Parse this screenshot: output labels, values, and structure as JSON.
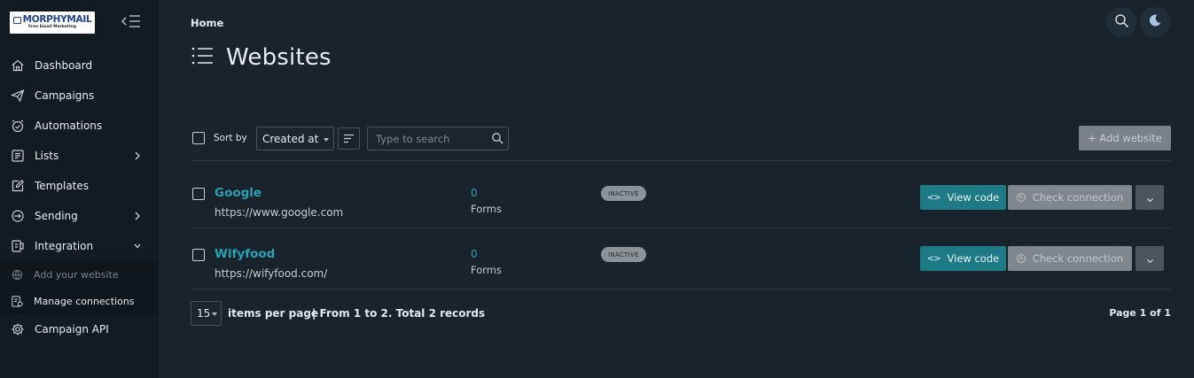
{
  "brand": {
    "name": "MORPHYMAIL",
    "tagline": "Free Email Marketing"
  },
  "sidebar": {
    "items": [
      {
        "label": "Dashboard",
        "icon": "home-icon"
      },
      {
        "label": "Campaigns",
        "icon": "send-icon"
      },
      {
        "label": "Automations",
        "icon": "alarm-icon"
      },
      {
        "label": "Lists",
        "icon": "list-icon",
        "expandable": true
      },
      {
        "label": "Templates",
        "icon": "edit-icon"
      },
      {
        "label": "Sending",
        "icon": "sending-icon",
        "expandable": true
      },
      {
        "label": "Integration",
        "icon": "integration-icon",
        "expanded": true
      }
    ],
    "sub_items": [
      {
        "label": "Add your website",
        "icon": "globe-icon"
      },
      {
        "label": "Manage connections",
        "icon": "connections-icon"
      }
    ],
    "bottom_items": [
      {
        "label": "Campaign API",
        "icon": "gear-icon"
      }
    ]
  },
  "header": {
    "breadcrumb": "Home",
    "title": "Websites"
  },
  "toolbar": {
    "sort_label": "Sort by",
    "sort_value": "Created at",
    "search_placeholder": "Type to search",
    "add_label": "+ Add website"
  },
  "websites": [
    {
      "name": "Google",
      "url": "https://www.google.com",
      "forms_count": "0",
      "forms_label": "Forms",
      "status": "INACTIVE",
      "view_label": "View code",
      "check_label": "Check connection"
    },
    {
      "name": "Wifyfood",
      "url": "https://wifyfood.com/",
      "forms_count": "0",
      "forms_label": "Forms",
      "status": "INACTIVE",
      "view_label": "View code",
      "check_label": "Check connection"
    }
  ],
  "pagination": {
    "per_page": "15",
    "per_page_label": "items per page",
    "range": "| From 1 to 2. Total 2 records",
    "page_info": "Page 1 of 1"
  },
  "colors": {
    "accent": "#2ba1b4",
    "primary_button": "#1e7a86",
    "background": "#18232b",
    "sidebar": "#121b21"
  }
}
